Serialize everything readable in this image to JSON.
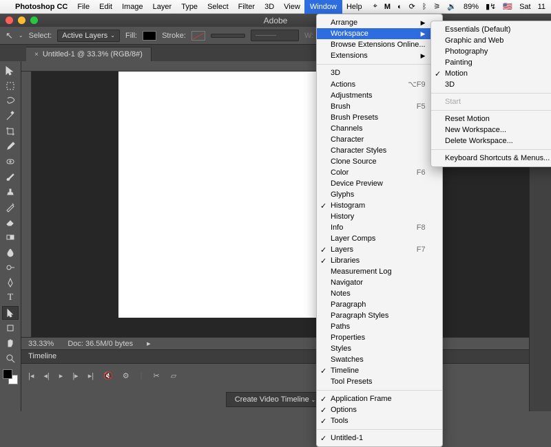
{
  "menubar": {
    "app": "Photoshop CC",
    "items": [
      "File",
      "Edit",
      "Image",
      "Layer",
      "Type",
      "Select",
      "Filter",
      "3D",
      "View",
      "Window",
      "Help"
    ],
    "active": "Window",
    "right": {
      "battery": "89%",
      "charging": true,
      "flag": "🇺🇸",
      "day": "Sat",
      "time": "11"
    }
  },
  "titlebar": {
    "title": "Adobe"
  },
  "optionsbar": {
    "select_label": "Select:",
    "select_value": "Active Layers",
    "fill_label": "Fill:",
    "stroke_label": "Stroke:"
  },
  "doc_tab": {
    "label": "Untitled-1 @ 33.3% (RGB/8#)"
  },
  "statusbar": {
    "zoom": "33.33%",
    "doc": "Doc: 36.5M/0 bytes"
  },
  "timeline": {
    "title": "Timeline",
    "create_btn": "Create Video Timeline"
  },
  "window_menu": [
    {
      "label": "Arrange",
      "arrow": true
    },
    {
      "label": "Workspace",
      "arrow": true,
      "hl": true
    },
    {
      "label": "Browse Extensions Online..."
    },
    {
      "label": "Extensions",
      "arrow": true
    },
    {
      "sep": true
    },
    {
      "label": "3D"
    },
    {
      "label": "Actions",
      "sc": "⌥F9"
    },
    {
      "label": "Adjustments"
    },
    {
      "label": "Brush",
      "sc": "F5"
    },
    {
      "label": "Brush Presets"
    },
    {
      "label": "Channels"
    },
    {
      "label": "Character"
    },
    {
      "label": "Character Styles"
    },
    {
      "label": "Clone Source"
    },
    {
      "label": "Color",
      "sc": "F6"
    },
    {
      "label": "Device Preview"
    },
    {
      "label": "Glyphs"
    },
    {
      "label": "Histogram",
      "check": true
    },
    {
      "label": "History"
    },
    {
      "label": "Info",
      "sc": "F8"
    },
    {
      "label": "Layer Comps"
    },
    {
      "label": "Layers",
      "check": true,
      "sc": "F7"
    },
    {
      "label": "Libraries",
      "check": true
    },
    {
      "label": "Measurement Log"
    },
    {
      "label": "Navigator"
    },
    {
      "label": "Notes"
    },
    {
      "label": "Paragraph"
    },
    {
      "label": "Paragraph Styles"
    },
    {
      "label": "Paths"
    },
    {
      "label": "Properties"
    },
    {
      "label": "Styles"
    },
    {
      "label": "Swatches"
    },
    {
      "label": "Timeline",
      "check": true
    },
    {
      "label": "Tool Presets"
    },
    {
      "sep": true
    },
    {
      "label": "Application Frame",
      "check": true
    },
    {
      "label": "Options",
      "check": true
    },
    {
      "label": "Tools",
      "check": true
    },
    {
      "sep": true
    },
    {
      "label": "Untitled-1",
      "check": true
    }
  ],
  "workspace_menu": [
    {
      "label": "Essentials (Default)"
    },
    {
      "label": "Graphic and Web"
    },
    {
      "label": "Photography"
    },
    {
      "label": "Painting"
    },
    {
      "label": "Motion",
      "check": true
    },
    {
      "label": "3D"
    },
    {
      "sep": true
    },
    {
      "label": "Start",
      "dis": true
    },
    {
      "sep": true
    },
    {
      "label": "Reset Motion"
    },
    {
      "label": "New Workspace..."
    },
    {
      "label": "Delete Workspace..."
    },
    {
      "sep": true
    },
    {
      "label": "Keyboard Shortcuts & Menus..."
    }
  ],
  "tools": [
    "move",
    "marquee",
    "lasso",
    "wand",
    "crop",
    "eyedrop",
    "heal",
    "brush",
    "stamp",
    "history",
    "eraser",
    "gradient",
    "blur",
    "dodge",
    "pen",
    "type",
    "path",
    "shape",
    "hand",
    "zoom"
  ]
}
